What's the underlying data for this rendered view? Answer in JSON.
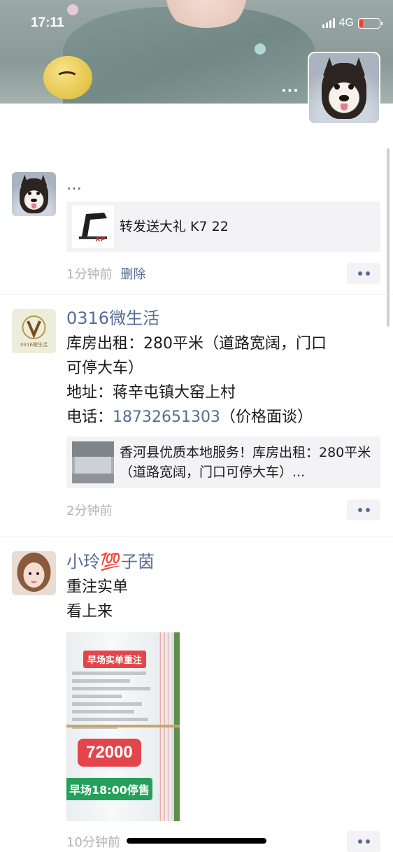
{
  "status_bar": {
    "time": "17:11",
    "network": "4G"
  },
  "cover": {
    "more": "..."
  },
  "posts": [
    {
      "nickname": "...",
      "link": {
        "title": "转发送大礼 K7 22",
        "thumb_text": "KP"
      },
      "time": "1分钟前",
      "delete_label": "删除"
    },
    {
      "nickname": "0316微生活",
      "avatar_text": "0316微生活",
      "lines": [
        "库房出租：280平米（道路宽阔，门口",
        "可停大车）",
        "地址：蒋辛屯镇大窑上村"
      ],
      "phone_prefix": "电话：",
      "phone": "18732651303",
      "phone_suffix": "（价格面谈）",
      "link": {
        "title": "香河县优质本地服务！库房出租：280平米（道路宽阔，门口可停大车）..."
      },
      "time": "2分钟前"
    },
    {
      "nickname": "小玲💯子茵",
      "lines": [
        "重注实单",
        "看上来"
      ],
      "image": {
        "badge": "早场实单重注",
        "amount": "72000",
        "stop_text": "早场18:00停售"
      },
      "time": "10分钟前"
    }
  ],
  "colors": {
    "link": "#576b95",
    "time": "#b2b2b2",
    "card_bg": "#f3f3f5"
  }
}
